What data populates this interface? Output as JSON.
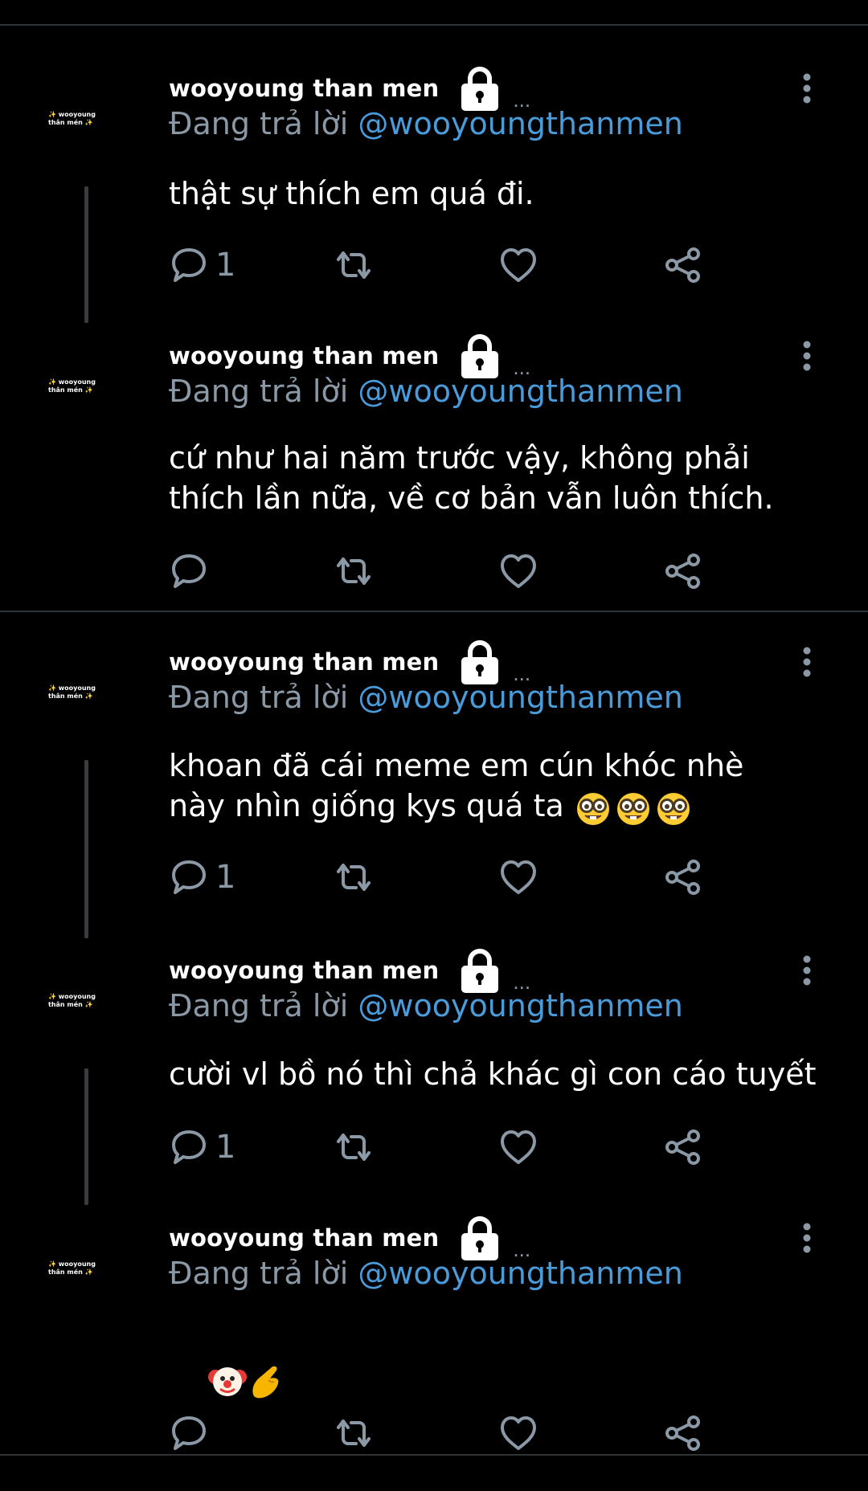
{
  "reply_prefix": "Đang trả lời",
  "avatar_text": {
    "sparkle": "✨",
    "line1": "wooyoung",
    "line2": "thân mén"
  },
  "tweets": [
    {
      "author": "wooyoung than men",
      "ellipsis": "...",
      "reply_handle": "@wooyoungthanmen",
      "text": "thật sự thích em quá đi.",
      "reply_count": "1"
    },
    {
      "author": "wooyoung than men",
      "ellipsis": "...",
      "reply_handle": "@wooyoungthanmen",
      "text": "cứ như hai năm trước vậy, không phải\nthích lần nữa, về cơ bản vẫn luôn thích.",
      "reply_count": ""
    },
    {
      "author": "wooyoung than men",
      "ellipsis": "...",
      "reply_handle": "@wooyoungthanmen",
      "text": "khoan đã cái meme em cún khóc nhè\nnày nhìn giống kys quá ta",
      "text_emoji": [
        "nerd-face",
        "nerd-face",
        "nerd-face"
      ],
      "reply_count": "1"
    },
    {
      "author": "wooyoung than men",
      "ellipsis": "...",
      "reply_handle": "@wooyoungthanmen",
      "text": "cười vl bồ nó thì chả khác gì con cáo tuyết",
      "reply_count": "1"
    },
    {
      "author": "wooyoung than men",
      "ellipsis": "...",
      "reply_handle": "@wooyoungthanmen",
      "text": "",
      "text_emoji": [
        "clown-face",
        "pinching-hand"
      ],
      "reply_count": ""
    }
  ],
  "colors": {
    "background": "#000000",
    "secondary": "#8b98a5",
    "link": "#4a9bd9",
    "divider": "#2f3336"
  },
  "icons": [
    "lock-icon",
    "more-vertical-icon",
    "reply-icon",
    "retweet-icon",
    "like-icon",
    "share-icon"
  ]
}
